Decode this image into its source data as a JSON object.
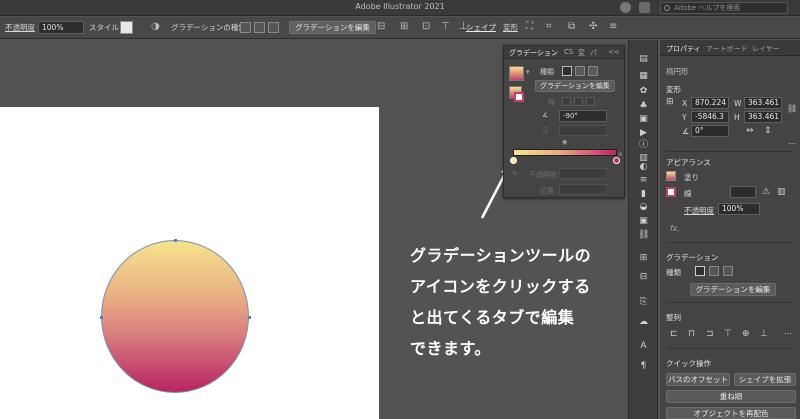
{
  "window": {
    "title": "Adobe Illustrator 2021",
    "help_placeholder": "Adobe ヘルプを検索"
  },
  "controlbar": {
    "opacity_label": "不透明度",
    "opacity_value": "100%",
    "style_label": "スタイル",
    "gradient_type_label": "グラデーションの種類",
    "edit_gradient_label": "グラデーションを編集",
    "shape_label": "シェイプ",
    "transform_label": "変形"
  },
  "gradient_panel": {
    "tabs": [
      "グラデーション",
      "CS",
      "変",
      "パ"
    ],
    "collapse_glyph": "<<",
    "type_label": "種類",
    "edit_button": "グラデーションを編集",
    "stroke_label": "線",
    "angle_value": "-90°",
    "opacity_label": "不透明度",
    "location_label": "位置",
    "stops": [
      "#f8e58c",
      "#c5245f"
    ]
  },
  "properties": {
    "tabs": [
      "プロパティ",
      "アートボード",
      "レイヤー"
    ],
    "object_type": "楕円形",
    "transform_header": "変形",
    "x_label": "X",
    "x_value": "870.224",
    "y_label": "Y",
    "y_value": "-5846.3",
    "w_label": "W",
    "w_value": "363.461",
    "h_label": "H",
    "h_value": "363.461",
    "rotate_value": "0°",
    "appearance_header": "アピアランス",
    "fill_label": "塗り",
    "stroke_label": "線",
    "opacity_label": "不透明度",
    "opacity_value": "100%",
    "fx_label": "fx.",
    "gradient_header": "グラデーション",
    "gradient_type_label": "種類",
    "gradient_edit_button": "グラデーションを編集",
    "align_header": "整列",
    "quick_actions_header": "クイック操作",
    "offset_path_button": "パスのオフセット",
    "expand_shape_button": "シェイプを拡張",
    "arrange_button": "重ね順",
    "recolor_button": "オブジェクトを再配色"
  },
  "annotation": {
    "lines": [
      "グラデーションツールの",
      "アイコンをクリックする",
      "と出てくるタブで編集",
      "できます。"
    ]
  },
  "colors": {
    "gradient_start": "#f6e38b",
    "gradient_end": "#b8245f",
    "ui_bg": "#535353",
    "panel_bg": "#444444"
  }
}
